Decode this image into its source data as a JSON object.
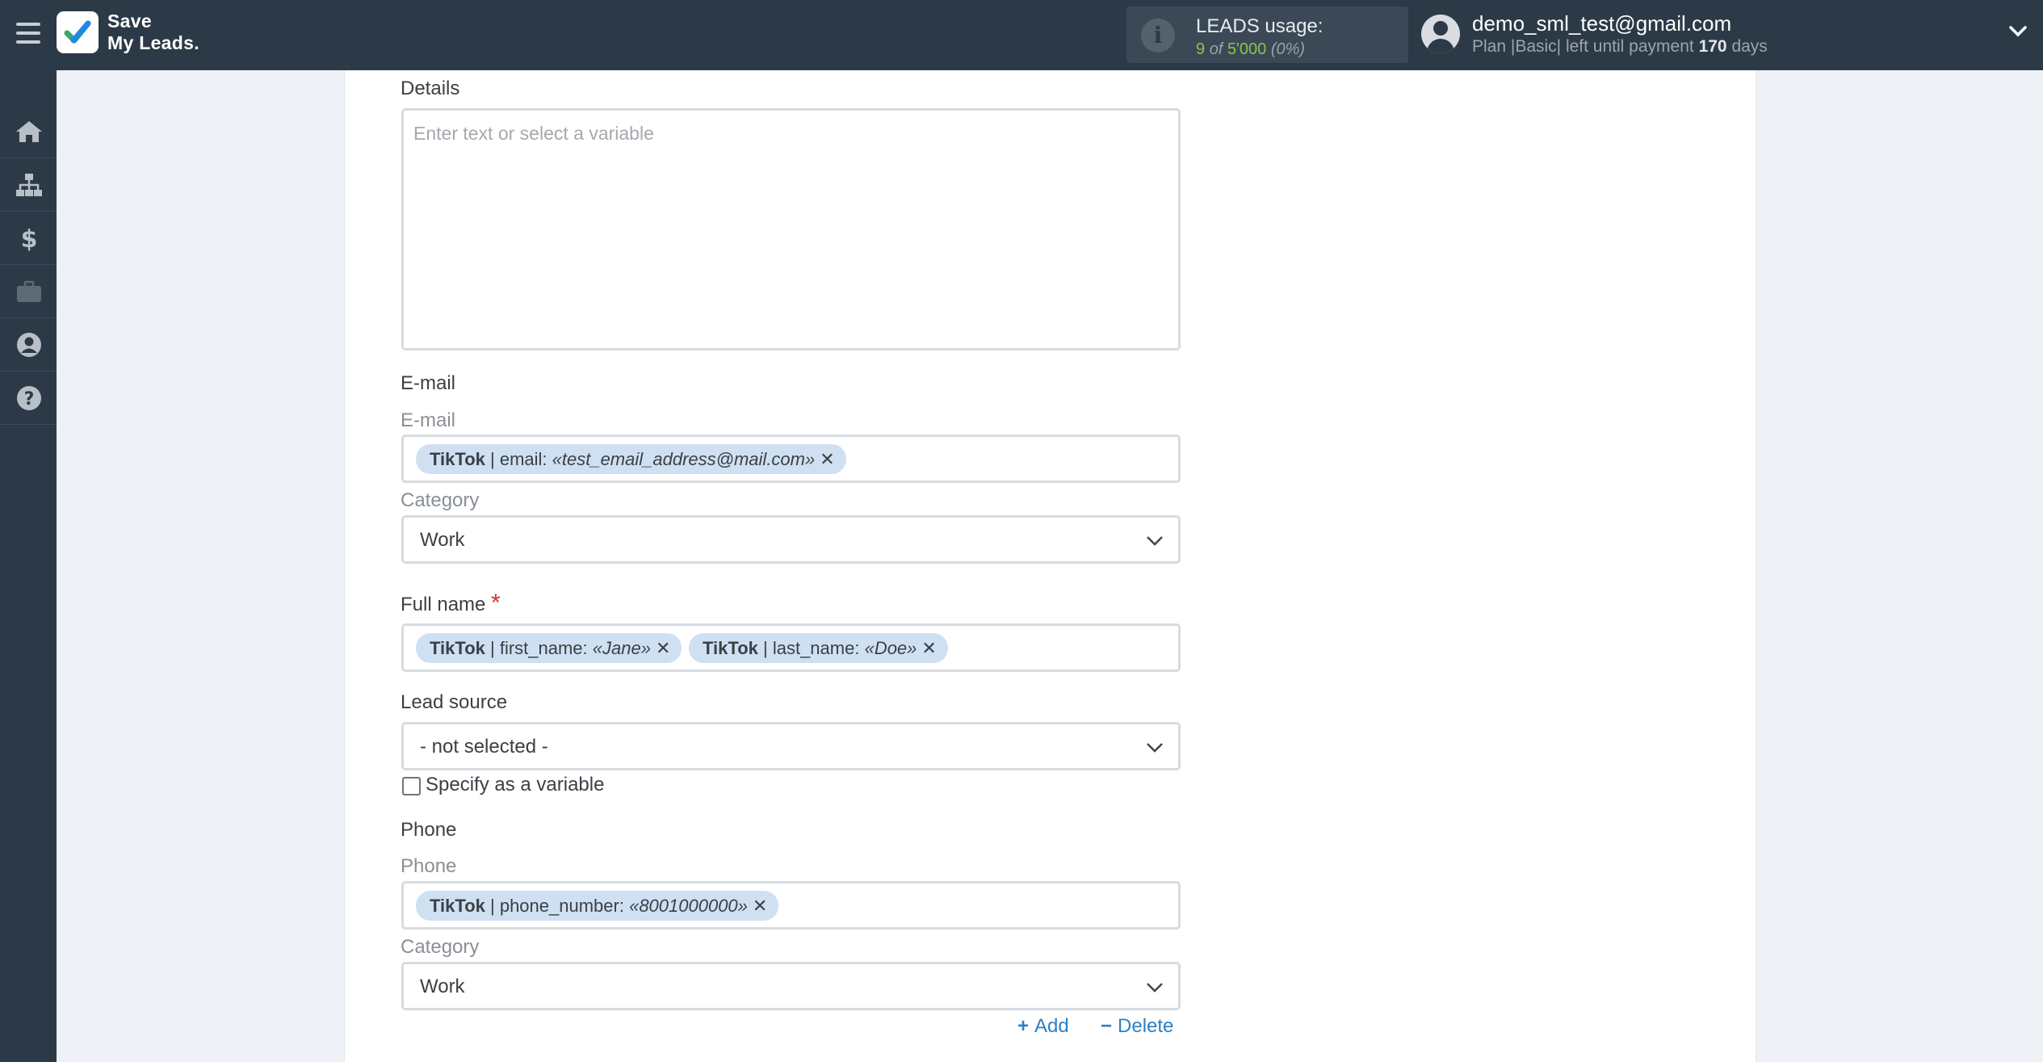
{
  "header": {
    "brand_line1": "Save",
    "brand_line2": "My Leads.",
    "usage_title": "LEADS usage:",
    "usage_used": "9",
    "usage_of": "of",
    "usage_total": "5'000",
    "usage_percent": "(0%)",
    "account_email": "demo_sml_test@gmail.com",
    "plan_prefix": "Plan |Basic| left until payment",
    "plan_days": "170",
    "plan_suffix": "days"
  },
  "sidebar": {
    "items": [
      {
        "icon": "home-icon"
      },
      {
        "icon": "sitemap-icon"
      },
      {
        "icon": "dollar-icon"
      },
      {
        "icon": "briefcase-icon"
      },
      {
        "icon": "user-circle-icon"
      },
      {
        "icon": "help-icon"
      }
    ]
  },
  "form": {
    "details": {
      "label": "Details",
      "placeholder": "Enter text or select a variable"
    },
    "email_section": {
      "title": "E-mail",
      "field_label": "E-mail",
      "chip": {
        "source": "TikTok",
        "field": "| email:",
        "value": "«test_email_address@mail.com»"
      },
      "category_label": "Category",
      "category_value": "Work"
    },
    "full_name": {
      "label": "Full name",
      "required_mark": "*",
      "chips": [
        {
          "source": "TikTok",
          "field": "| first_name:",
          "value": "«Jane»"
        },
        {
          "source": "TikTok",
          "field": "| last_name:",
          "value": "«Doe»"
        }
      ]
    },
    "lead_source": {
      "label": "Lead source",
      "value": "- not selected -",
      "checkbox_label": "Specify as a variable"
    },
    "phone_section": {
      "title": "Phone",
      "field_label": "Phone",
      "chip": {
        "source": "TikTok",
        "field": "| phone_number:",
        "value": "«8001000000»"
      },
      "category_label": "Category",
      "category_value": "Work"
    },
    "actions": {
      "add_label": "Add",
      "add_symbol": "+",
      "delete_label": "Delete",
      "delete_symbol": "−"
    }
  },
  "colors": {
    "sidebar_bg": "#2c3a47",
    "chip_bg": "#cfe0f2",
    "link": "#2f80c3",
    "usage_green": "#8bc34a",
    "required": "#d32f2f"
  }
}
